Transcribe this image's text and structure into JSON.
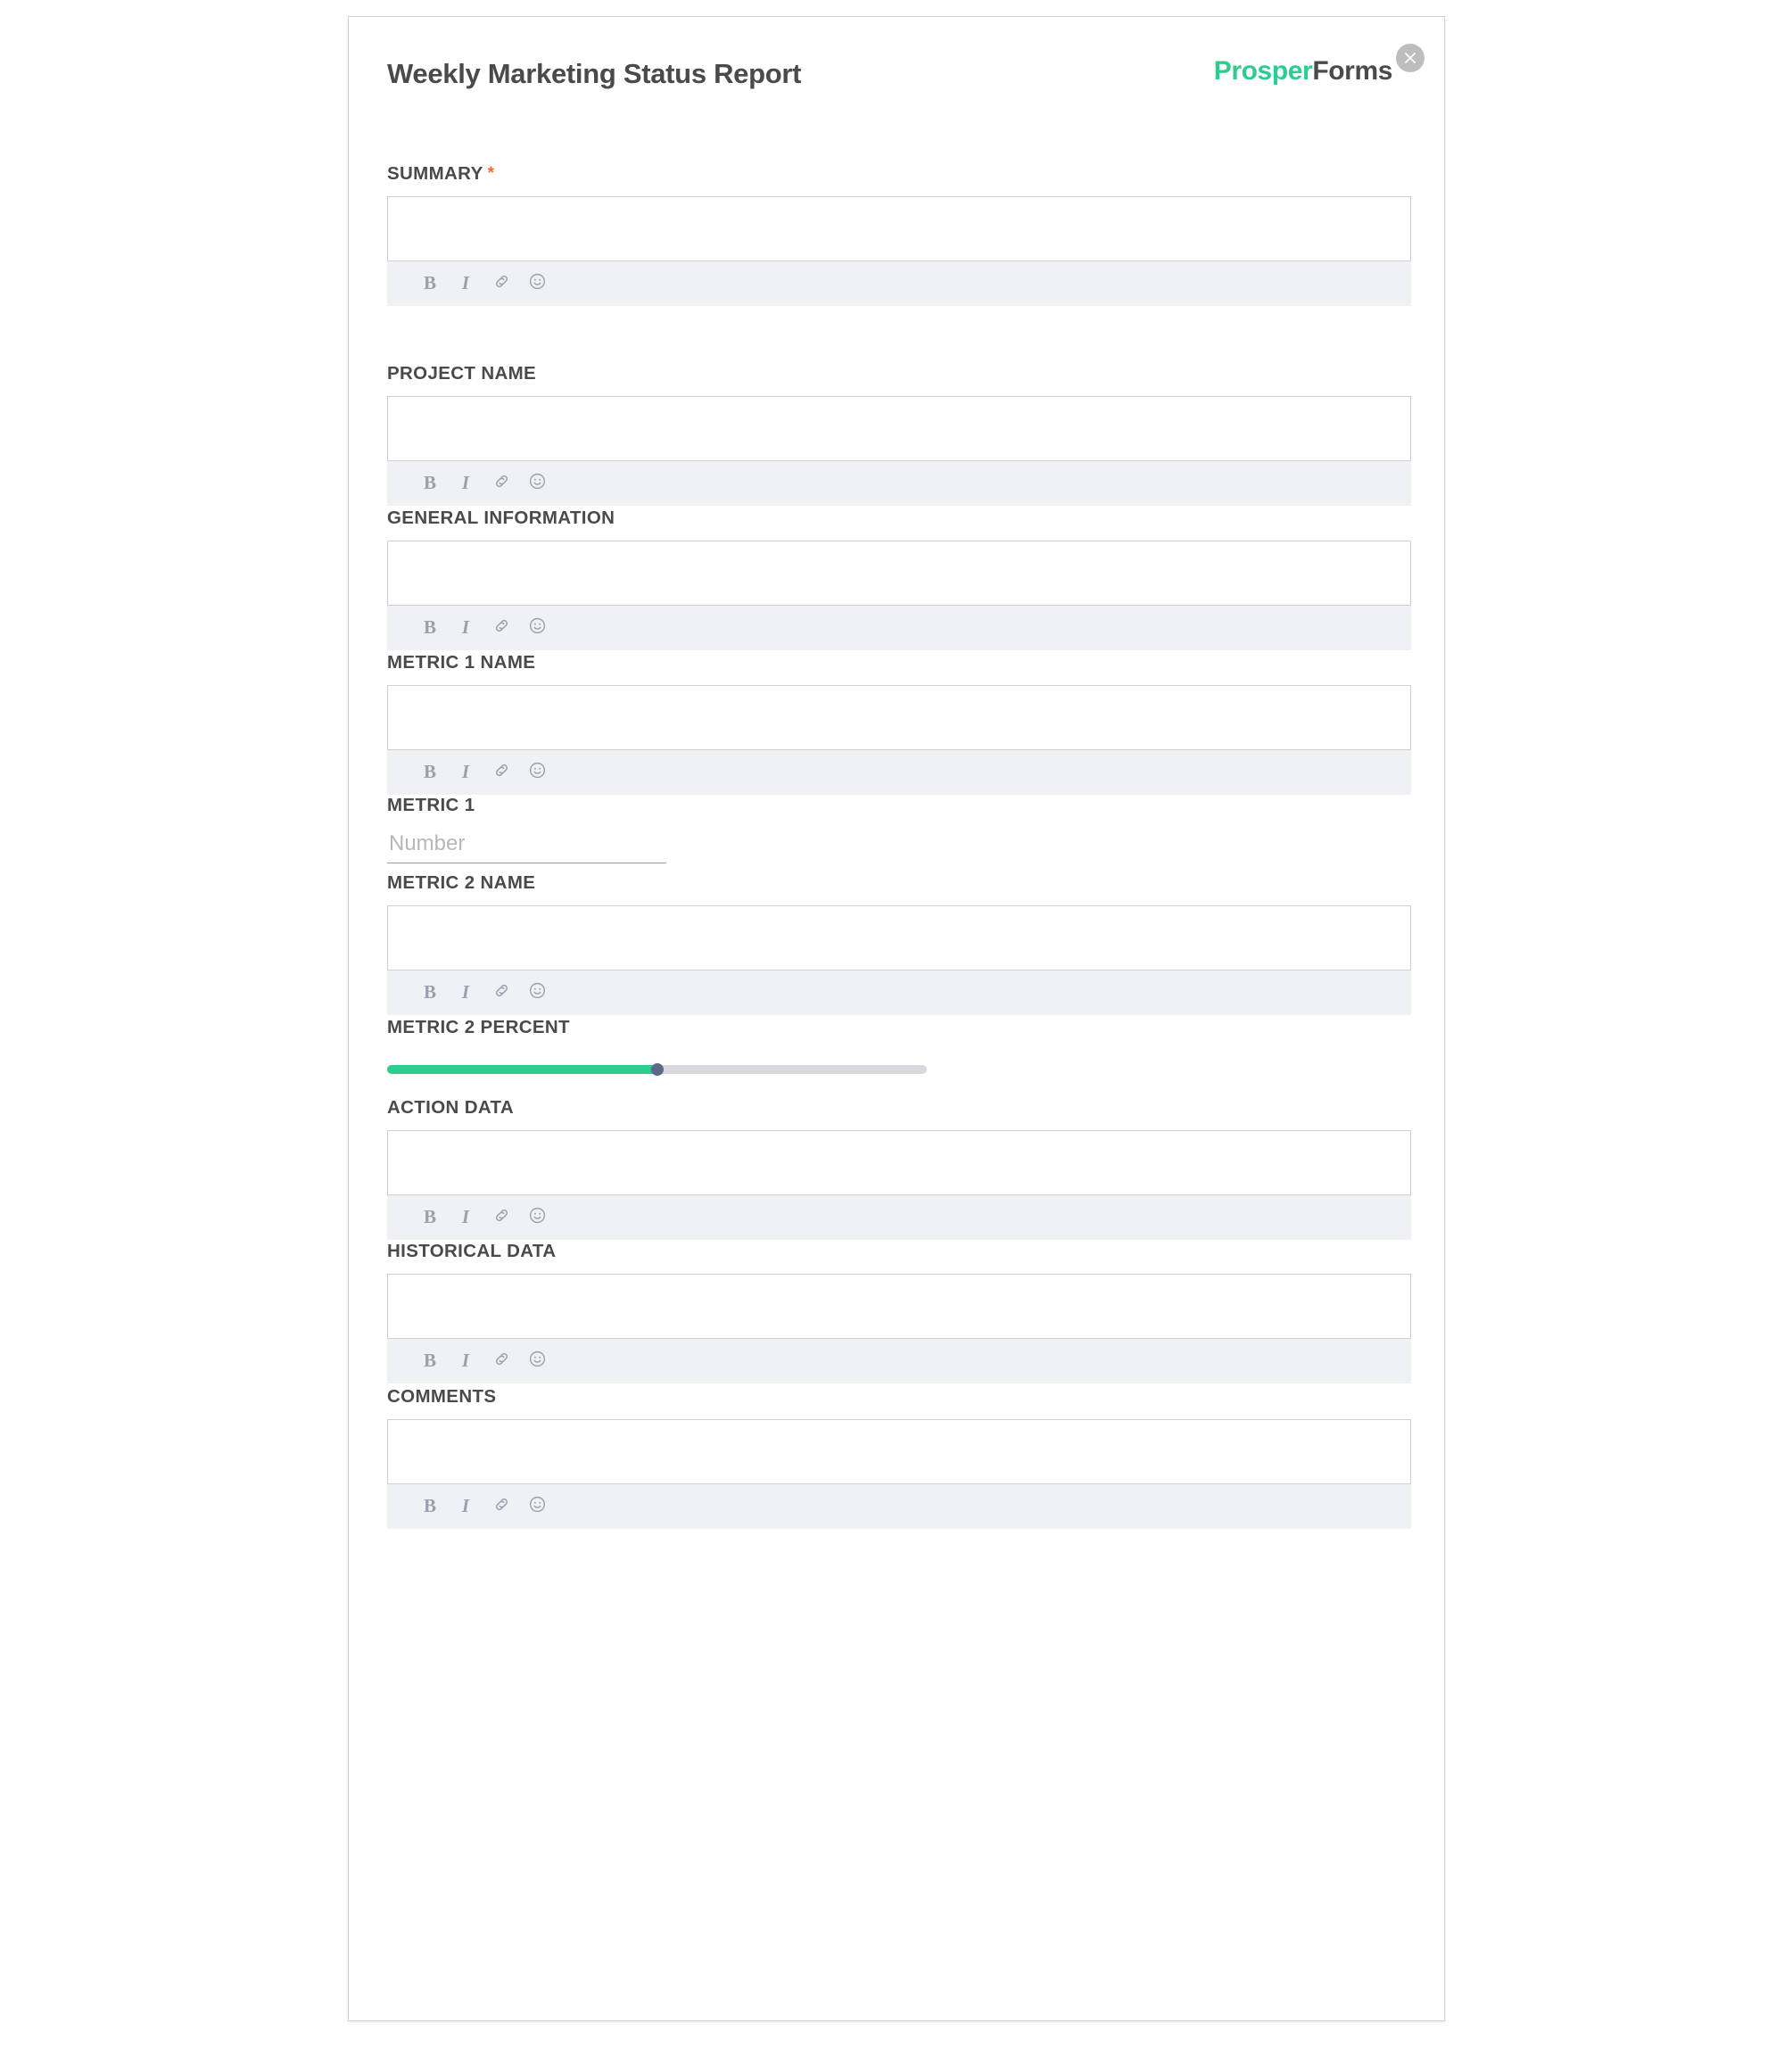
{
  "header": {
    "title": "Weekly Marketing Status Report",
    "brand_first": "Prosper",
    "brand_second": "Forms",
    "close_icon": "close-icon"
  },
  "toolbar": {
    "bold_label": "B",
    "italic_label": "I",
    "link_icon": "link-icon",
    "emoji_icon": "emoji-icon"
  },
  "colors": {
    "brand_green": "#2ecc8f",
    "label_gray": "#4a4a4a",
    "required_orange": "#ec6b31",
    "toolbar_bg": "#f0f1f5",
    "slider_track": "#d7d9de",
    "slider_handle": "#5c6a86",
    "close_button": "#bdbdbd"
  },
  "fields": [
    {
      "id": "summary",
      "label": "SUMMARY",
      "required": true,
      "required_marker": "*",
      "type": "richtext",
      "value": ""
    },
    {
      "id": "project-name",
      "label": "PROJECT NAME",
      "required": false,
      "type": "richtext",
      "value": ""
    },
    {
      "id": "general-information",
      "label": "GENERAL INFORMATION",
      "required": false,
      "type": "richtext",
      "value": ""
    },
    {
      "id": "metric-1-name",
      "label": "METRIC 1 NAME",
      "required": false,
      "type": "richtext",
      "value": ""
    },
    {
      "id": "metric-1",
      "label": "METRIC 1",
      "required": false,
      "type": "number",
      "value": "",
      "placeholder": "Number"
    },
    {
      "id": "metric-2-name",
      "label": "METRIC 2 NAME",
      "required": false,
      "type": "richtext",
      "value": ""
    },
    {
      "id": "metric-2-percent",
      "label": "METRIC 2 PERCENT",
      "required": false,
      "type": "slider",
      "value": 50,
      "min": 0,
      "max": 100
    },
    {
      "id": "action-data",
      "label": "ACTION DATA",
      "required": false,
      "type": "richtext",
      "value": ""
    },
    {
      "id": "historical-data",
      "label": "HISTORICAL DATA",
      "required": false,
      "type": "richtext",
      "value": ""
    },
    {
      "id": "comments",
      "label": "COMMENTS",
      "required": false,
      "type": "richtext",
      "value": ""
    }
  ]
}
